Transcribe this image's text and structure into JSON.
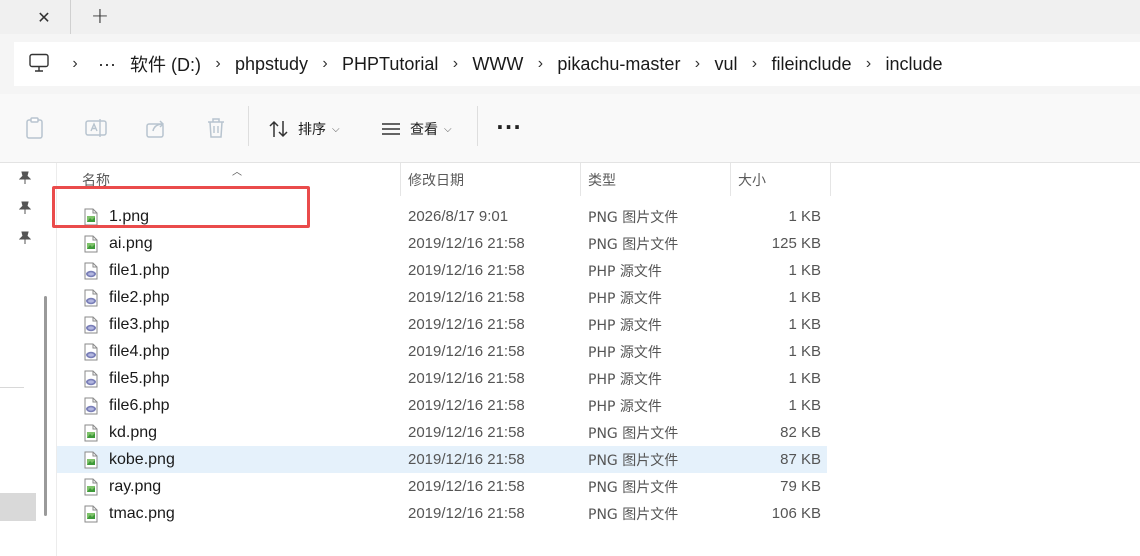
{
  "tabs": {
    "close_glyph": "✕",
    "new_glyph": "+"
  },
  "address": {
    "overflow": "···",
    "crumbs": [
      "软件 (D:)",
      "phpstudy",
      "PHPTutorial",
      "WWW",
      "pikachu-master",
      "vul",
      "fileinclude",
      "include"
    ]
  },
  "toolbar": {
    "sort_label": "排序",
    "view_label": "查看",
    "more_label": "···"
  },
  "columns": {
    "name": "名称",
    "date": "修改日期",
    "type": "类型",
    "size": "大小"
  },
  "files": [
    {
      "name": "1.png",
      "date": "2026/8/17 9:01",
      "type": "PNG 图片文件",
      "size": "1 KB",
      "icon": "png-file-icon"
    },
    {
      "name": "ai.png",
      "date": "2019/12/16 21:58",
      "type": "PNG 图片文件",
      "size": "125 KB",
      "icon": "png-file-icon"
    },
    {
      "name": "file1.php",
      "date": "2019/12/16 21:58",
      "type": "PHP 源文件",
      "size": "1 KB",
      "icon": "php-file-icon"
    },
    {
      "name": "file2.php",
      "date": "2019/12/16 21:58",
      "type": "PHP 源文件",
      "size": "1 KB",
      "icon": "php-file-icon"
    },
    {
      "name": "file3.php",
      "date": "2019/12/16 21:58",
      "type": "PHP 源文件",
      "size": "1 KB",
      "icon": "php-file-icon"
    },
    {
      "name": "file4.php",
      "date": "2019/12/16 21:58",
      "type": "PHP 源文件",
      "size": "1 KB",
      "icon": "php-file-icon"
    },
    {
      "name": "file5.php",
      "date": "2019/12/16 21:58",
      "type": "PHP 源文件",
      "size": "1 KB",
      "icon": "php-file-icon"
    },
    {
      "name": "file6.php",
      "date": "2019/12/16 21:58",
      "type": "PHP 源文件",
      "size": "1 KB",
      "icon": "php-file-icon"
    },
    {
      "name": "kd.png",
      "date": "2019/12/16 21:58",
      "type": "PNG 图片文件",
      "size": "82 KB",
      "icon": "png-file-icon"
    },
    {
      "name": "kobe.png",
      "date": "2019/12/16 21:58",
      "type": "PNG 图片文件",
      "size": "87 KB",
      "icon": "png-file-icon",
      "selected": true
    },
    {
      "name": "ray.png",
      "date": "2019/12/16 21:58",
      "type": "PNG 图片文件",
      "size": "79 KB",
      "icon": "png-file-icon"
    },
    {
      "name": "tmac.png",
      "date": "2019/12/16 21:58",
      "type": "PNG 图片文件",
      "size": "106 KB",
      "icon": "png-file-icon"
    }
  ],
  "colors": {
    "annotation": "#ea4b4b",
    "selection": "#e5f1fb"
  }
}
